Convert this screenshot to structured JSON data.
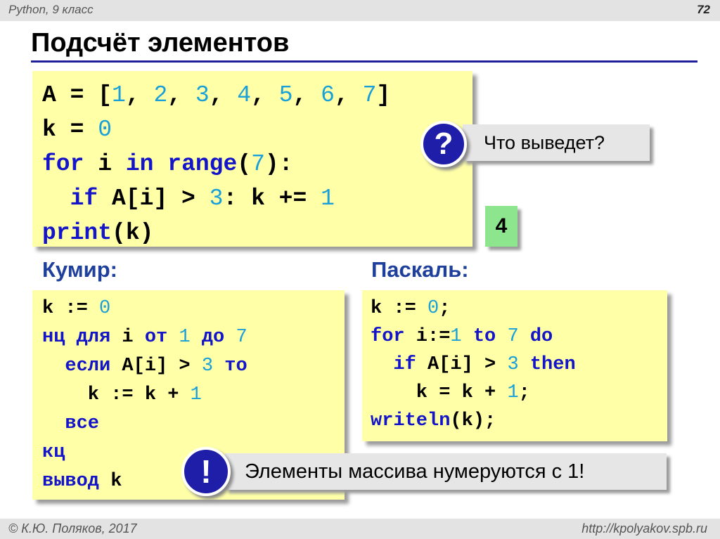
{
  "header": {
    "course": "Python, 9 класс",
    "page": "72"
  },
  "title": "Подсчёт элементов",
  "python_code": {
    "l1": {
      "a": "A = [",
      "n1": "1",
      "c1": ", ",
      "n2": "2",
      "c2": ", ",
      "n3": "3",
      "c3": ", ",
      "n4": "4",
      "c4": ", ",
      "n5": "5",
      "c5": ", ",
      "n6": "6",
      "c6": ", ",
      "n7": "7",
      "end": "]"
    },
    "l2": {
      "a": "k = ",
      "n": "0"
    },
    "l3": {
      "kw1": "for",
      "a": " i ",
      "kw2": "in",
      "b": " ",
      "kw3": "range",
      "c": "(",
      "n": "7",
      "d": "):"
    },
    "l4": {
      "pad": "  ",
      "kw": "if",
      "a": " A[i] > ",
      "n1": "3",
      "b": ": k += ",
      "n2": "1"
    },
    "l5": {
      "kw": "print",
      "a": "(k)"
    }
  },
  "question": {
    "symbol": "?",
    "text": "Что выведет?"
  },
  "answer": "4",
  "kumir": {
    "heading": "Кумир:",
    "l1": {
      "a": "k := ",
      "n": "0"
    },
    "l2": {
      "kw1": "нц для",
      "a": " i ",
      "kw2": "от",
      "b": " ",
      "n1": "1",
      "c": " ",
      "kw3": "до",
      "d": " ",
      "n2": "7"
    },
    "l3": {
      "pad": "  ",
      "kw1": "если",
      "a": " A[i] > ",
      "n": "3",
      "b": " ",
      "kw2": "то"
    },
    "l4": {
      "a": "    k := k + ",
      "n": "1"
    },
    "l5": {
      "pad": "  ",
      "kw": "все"
    },
    "l6": {
      "kw": "кц"
    },
    "l7": {
      "kw": "вывод",
      "a": " k"
    }
  },
  "pascal": {
    "heading": "Паскаль:",
    "l1": {
      "a": "k := ",
      "n": "0",
      "b": ";"
    },
    "l2": {
      "kw1": "for",
      "a": " i:=",
      "n1": "1",
      "b": " ",
      "kw2": "to",
      "c": " ",
      "n2": "7",
      "d": " ",
      "kw3": "do"
    },
    "l3": {
      "pad": "  ",
      "kw1": "if",
      "a": " A[i] > ",
      "n": "3",
      "b": " ",
      "kw2": "then"
    },
    "l4": {
      "a": "    k = k + ",
      "n": "1",
      "b": ";"
    },
    "l5": {
      "kw": "writeln",
      "a": "(k);"
    }
  },
  "note": {
    "symbol": "!",
    "text": "Элементы массива нумеруются с 1!"
  },
  "footer": {
    "copyright": "© К.Ю. Поляков, 2017",
    "url": "http://kpolyakov.spb.ru"
  },
  "colors": {
    "code_bg": "#ffffa8",
    "keyword": "#1414c8",
    "number": "#1aa0d8",
    "heading": "#1f3f9c",
    "badge": "#1e1ea8",
    "answer_bg": "#8de58d"
  }
}
